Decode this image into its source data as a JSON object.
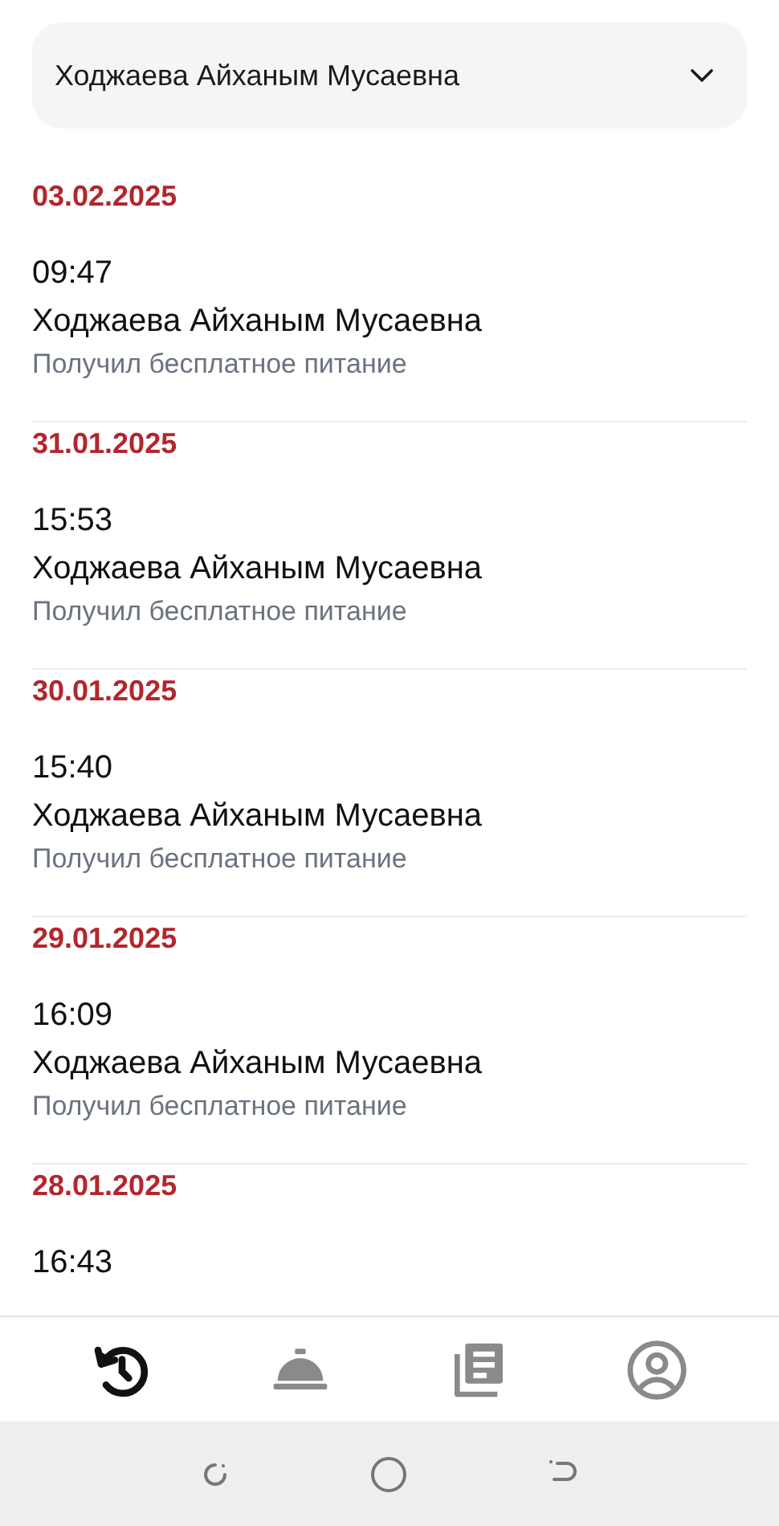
{
  "selector": {
    "value": "Ходжаева Айханым Мусаевна"
  },
  "groups": [
    {
      "date": "03.02.2025",
      "time": "09:47",
      "name": "Ходжаева Айханым Мусаевна",
      "status": "Получил бесплатное питание"
    },
    {
      "date": "31.01.2025",
      "time": "15:53",
      "name": "Ходжаева Айханым Мусаевна",
      "status": "Получил бесплатное питание"
    },
    {
      "date": "30.01.2025",
      "time": "15:40",
      "name": "Ходжаева Айханым Мусаевна",
      "status": "Получил бесплатное питание"
    },
    {
      "date": "29.01.2025",
      "time": "16:09",
      "name": "Ходжаева Айханым Мусаевна",
      "status": "Получил бесплатное питание"
    },
    {
      "date": "28.01.2025",
      "time": "16:43"
    }
  ],
  "tabs": [
    {
      "kind": "history",
      "selected": true
    },
    {
      "kind": "service",
      "selected": false
    },
    {
      "kind": "library",
      "selected": false
    },
    {
      "kind": "profile",
      "selected": false
    }
  ]
}
